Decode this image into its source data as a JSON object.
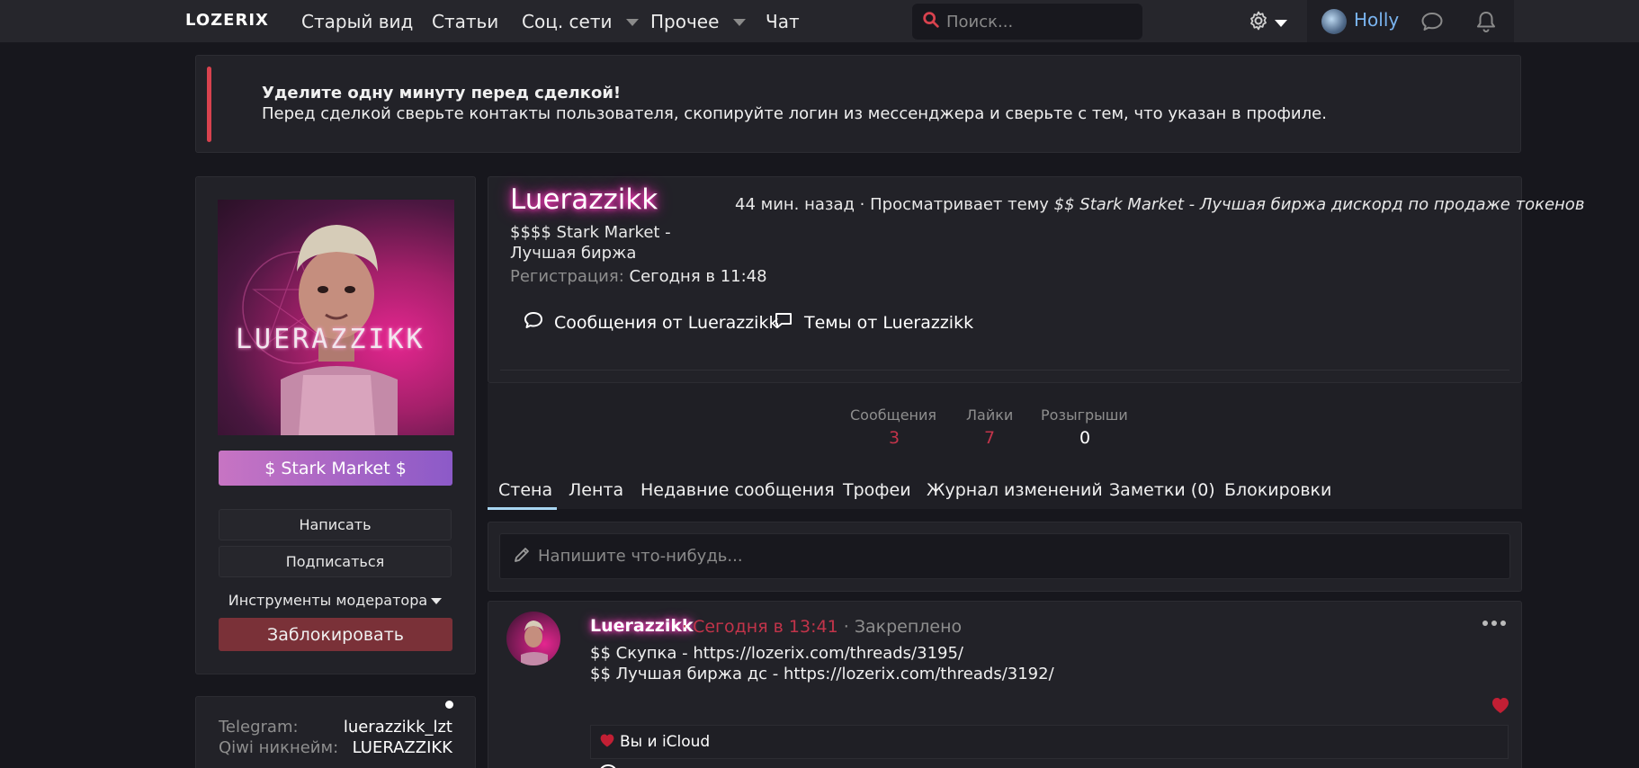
{
  "nav": {
    "logo": "LOZERIX",
    "items": [
      {
        "label": "Старый вид"
      },
      {
        "label": "Статьи"
      },
      {
        "label": "Соц. сети"
      },
      {
        "label": "Прочее"
      },
      {
        "label": "Чат"
      }
    ],
    "search_placeholder": "Поиск...",
    "user_name": "Holly"
  },
  "notice": {
    "title": "Уделите одну минуту перед сделкой!",
    "text": "Перед сделкой сверьте контакты пользователя, скопируйте логин из мессенджера и сверьте с тем, что указан в профиле."
  },
  "sidebar": {
    "avatar_text": "LUERAZZIKK",
    "user_title": "$ Stark Market $",
    "buttons": {
      "write": "Написать",
      "subscribe": "Подписаться",
      "mod_tools": "Инструменты модератора",
      "block": "Заблокировать"
    },
    "contacts": [
      {
        "label": "Telegram:",
        "value": "luerazzikk_lzt"
      },
      {
        "label": "Qiwi никнейм:",
        "value": "LUERAZZIKK"
      }
    ]
  },
  "profile": {
    "username": "Luerazzikk",
    "status": "$$$$ Stark Market - Лучшая биржа",
    "reg_label": "Регистрация:",
    "reg_value": "Сегодня в 11:48",
    "activity_prefix": "44 мин. назад · Просматривает тему",
    "activity_thread": "$$ Stark Market - Лучшая биржа дискорд по продаже токенов",
    "link_messages": "Сообщения от Luerazzikk",
    "link_threads": "Темы от Luerazzikk"
  },
  "stats": [
    {
      "label": "Сообщения",
      "value": "3"
    },
    {
      "label": "Лайки",
      "value": "7"
    },
    {
      "label": "Розыгрыши",
      "value": "0"
    }
  ],
  "tabs": [
    {
      "label": "Стена"
    },
    {
      "label": "Лента"
    },
    {
      "label": "Недавние сообщения"
    },
    {
      "label": "Трофеи"
    },
    {
      "label": "Журнал изменений"
    },
    {
      "label": "Заметки (0)"
    },
    {
      "label": "Блокировки"
    }
  ],
  "compose_placeholder": "Напишите что-нибудь...",
  "post": {
    "author": "Luerazzikk",
    "sep1": "·",
    "time": "Сегодня в 13:41",
    "pinned": "· Закреплено",
    "line1": "$$ Скупка - https://lozerix.com/threads/3195/",
    "line2": "$$ Лучшая биржа дс - https://lozerix.com/threads/3192/",
    "likes_text": "Вы и iCloud"
  },
  "colors": {
    "accent_red": "#c2344a",
    "link_blue": "#7ab4f0",
    "username_glow": "#ff3fbf",
    "block_button": "#7a3138"
  }
}
